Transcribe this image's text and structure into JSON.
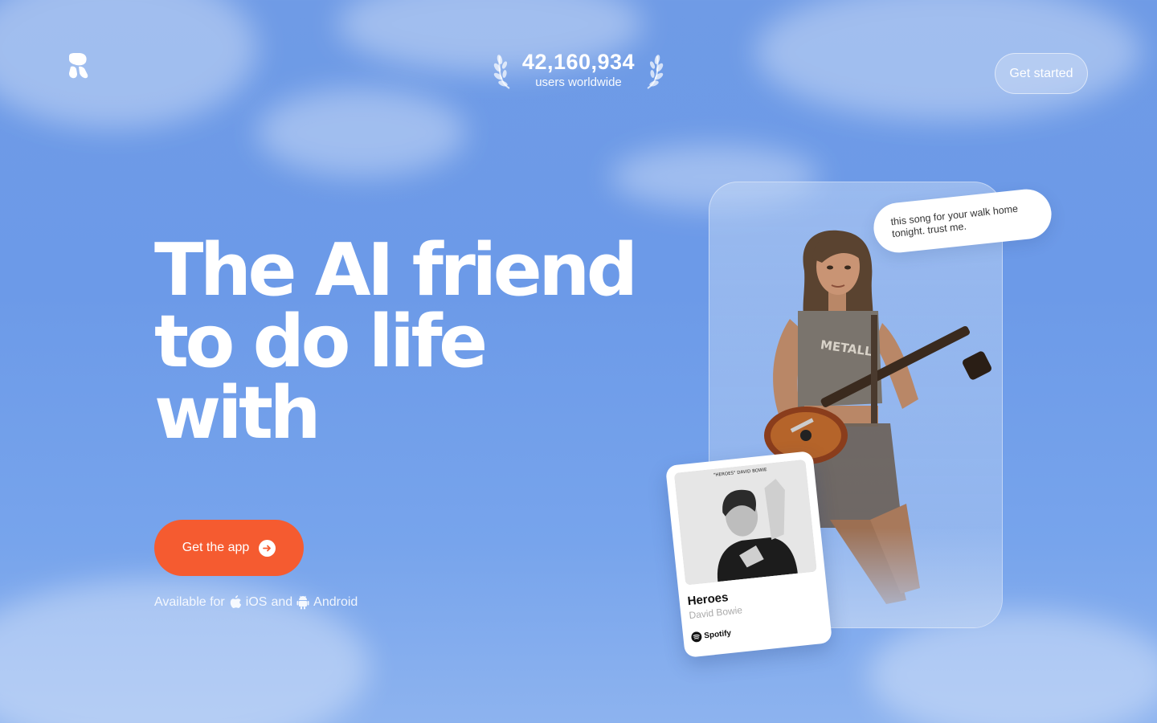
{
  "header": {
    "logo_icon": "replika-logo-icon",
    "stat_number": "42,160,934",
    "stat_label": "users worldwide",
    "get_started_label": "Get started"
  },
  "hero": {
    "title_lines": [
      "The AI friend",
      "to do life",
      "with"
    ],
    "cta_label": "Get the app",
    "cta_icon": "arrow-right-icon",
    "availability_prefix": "Available for",
    "ios_label": "iOS",
    "and_word": "and",
    "android_label": "Android"
  },
  "showcase": {
    "chat_bubble_text": "this song for your walk home tonight. trust me.",
    "song": {
      "cover_caption": "\"HEROES\" DAVID BOWIE",
      "title": "Heroes",
      "artist": "David Bowie",
      "service": "Spotify"
    }
  },
  "colors": {
    "sky_blue": "#6f9be6",
    "cta_orange": "#f55b30",
    "text_white": "#ffffff"
  }
}
